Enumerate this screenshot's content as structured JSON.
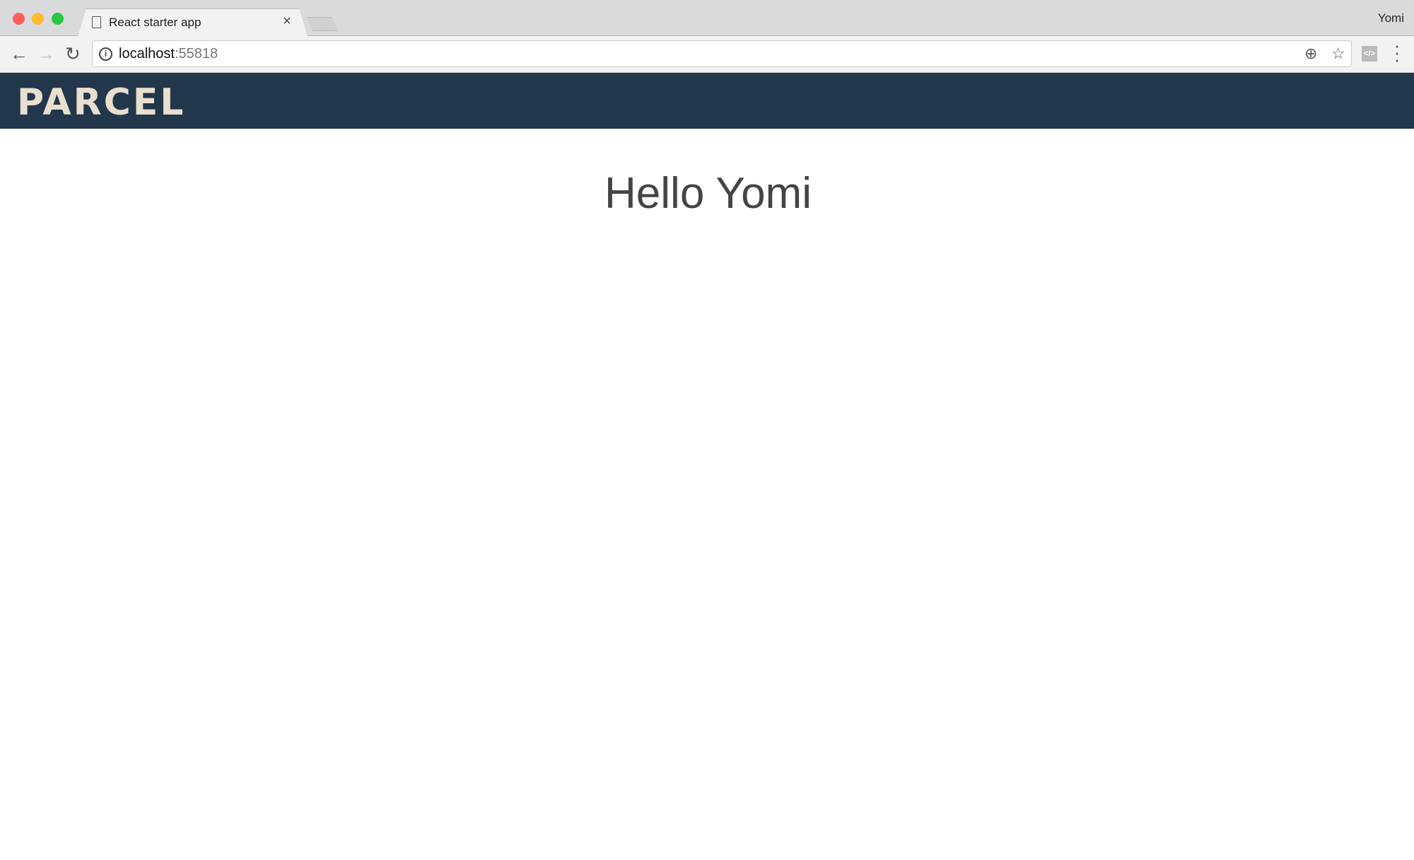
{
  "browser": {
    "tab_title": "React starter app",
    "tab_close": "×",
    "profile_name": "Yomi",
    "url_host": "localhost",
    "url_port": ":55818",
    "traffic_lights": {
      "close": "#fd5f57",
      "minimize": "#febb2e",
      "maximize": "#28c840"
    }
  },
  "header": {
    "logo_text": "PARCEL",
    "background": "#22364c"
  },
  "main": {
    "greeting": "Hello Yomi"
  }
}
